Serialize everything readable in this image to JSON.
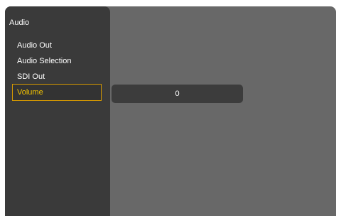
{
  "menu": {
    "title": "Audio",
    "items": [
      {
        "label": "Audio Out"
      },
      {
        "label": "Audio Selection"
      },
      {
        "label": "SDI Out"
      },
      {
        "label": "Volume",
        "selected": true
      }
    ]
  },
  "volume": {
    "value": "0"
  },
  "colors": {
    "sidebar_bg": "#3a3a3a",
    "content_bg": "#686868",
    "selected_text": "#f5c400",
    "selected_border": "#d79a00",
    "field_bg": "#3c3c3c"
  }
}
